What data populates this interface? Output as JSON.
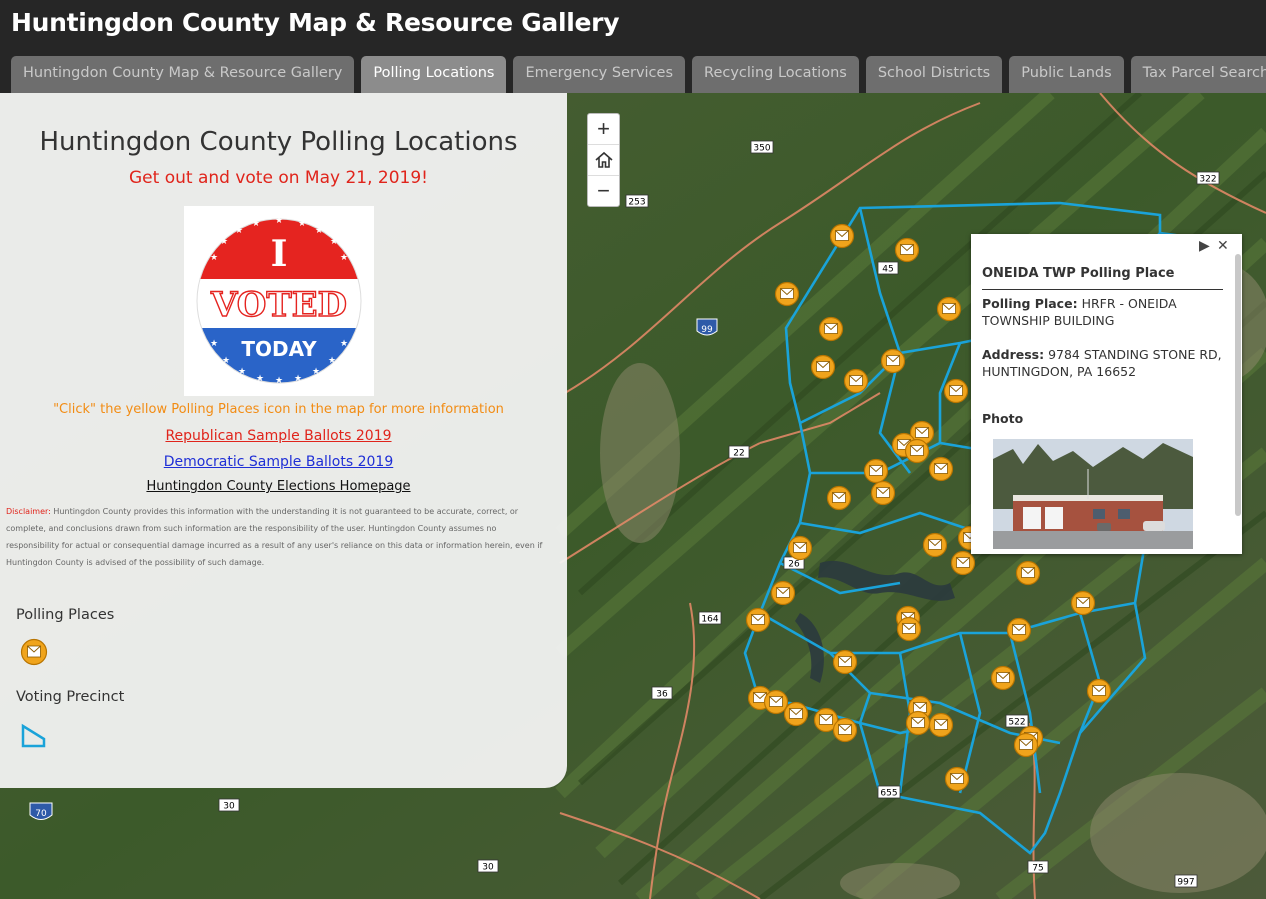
{
  "app": {
    "title": "Huntingdon County Map & Resource Gallery"
  },
  "tabs": [
    {
      "label": "Huntingdon County Map & Resource Gallery",
      "active": false
    },
    {
      "label": "Polling Locations",
      "active": true
    },
    {
      "label": "Emergency Services",
      "active": false
    },
    {
      "label": "Recycling Locations",
      "active": false
    },
    {
      "label": "School Districts",
      "active": false
    },
    {
      "label": "Public Lands",
      "active": false
    },
    {
      "label": "Tax Parcel Search",
      "active": false
    }
  ],
  "panel": {
    "title": "Huntingdon County Polling Locations",
    "subtitle": "Get out and vote on May 21, 2019!",
    "badge": {
      "top": "I",
      "middle": "VOTED",
      "bottom": "TODAY"
    },
    "instruction": "\"Click\" the yellow Polling Places icon in the map for more information",
    "links": {
      "republican": "Republican Sample Ballots 2019",
      "democratic": "Democratic Sample Ballots 2019",
      "homepage": "Huntingdon County Elections Homepage"
    },
    "disclaimer_label": "Disclaimer:",
    "disclaimer_text": "Huntingdon County provides this information with the understanding it is not guaranteed to be accurate, correct, or complete, and conclusions drawn from such information are the responsibility of the user. Huntingdon County assumes no responsibility for actual or consequential damage incurred as a result of any user's reliance on this data or information herein, even if Huntingdon County is advised of the possibility of such damage."
  },
  "legend": {
    "polling_places": "Polling Places",
    "voting_precinct": "Voting Precinct"
  },
  "map": {
    "zoom_in": "+",
    "home": "home-icon",
    "zoom_out": "−",
    "route_labels": [
      "350",
      "253",
      "322",
      "45",
      "99",
      "22",
      "26",
      "164",
      "36",
      "30",
      "70",
      "75",
      "522",
      "655",
      "997",
      "30"
    ]
  },
  "popup": {
    "title": "ONEIDA TWP Polling Place",
    "polling_place_label": "Polling Place:",
    "polling_place_value": "HRFR - ONEIDA TOWNSHIP BUILDING",
    "address_label": "Address:",
    "address_value": "9784 STANDING STONE RD, HUNTINGDON, PA 16652",
    "photo_label": "Photo",
    "close": "✕",
    "next": "▶"
  },
  "colors": {
    "header_bg": "#262626",
    "tab_bg": "#6e6e6e",
    "tab_active_bg": "#8c8c8c",
    "accent_red": "#e0241b",
    "accent_blue": "#1f2fd6",
    "instruction_orange": "#f28c14",
    "precinct_blue": "#1aa3d9",
    "marker_gold": "#f0a41c"
  }
}
